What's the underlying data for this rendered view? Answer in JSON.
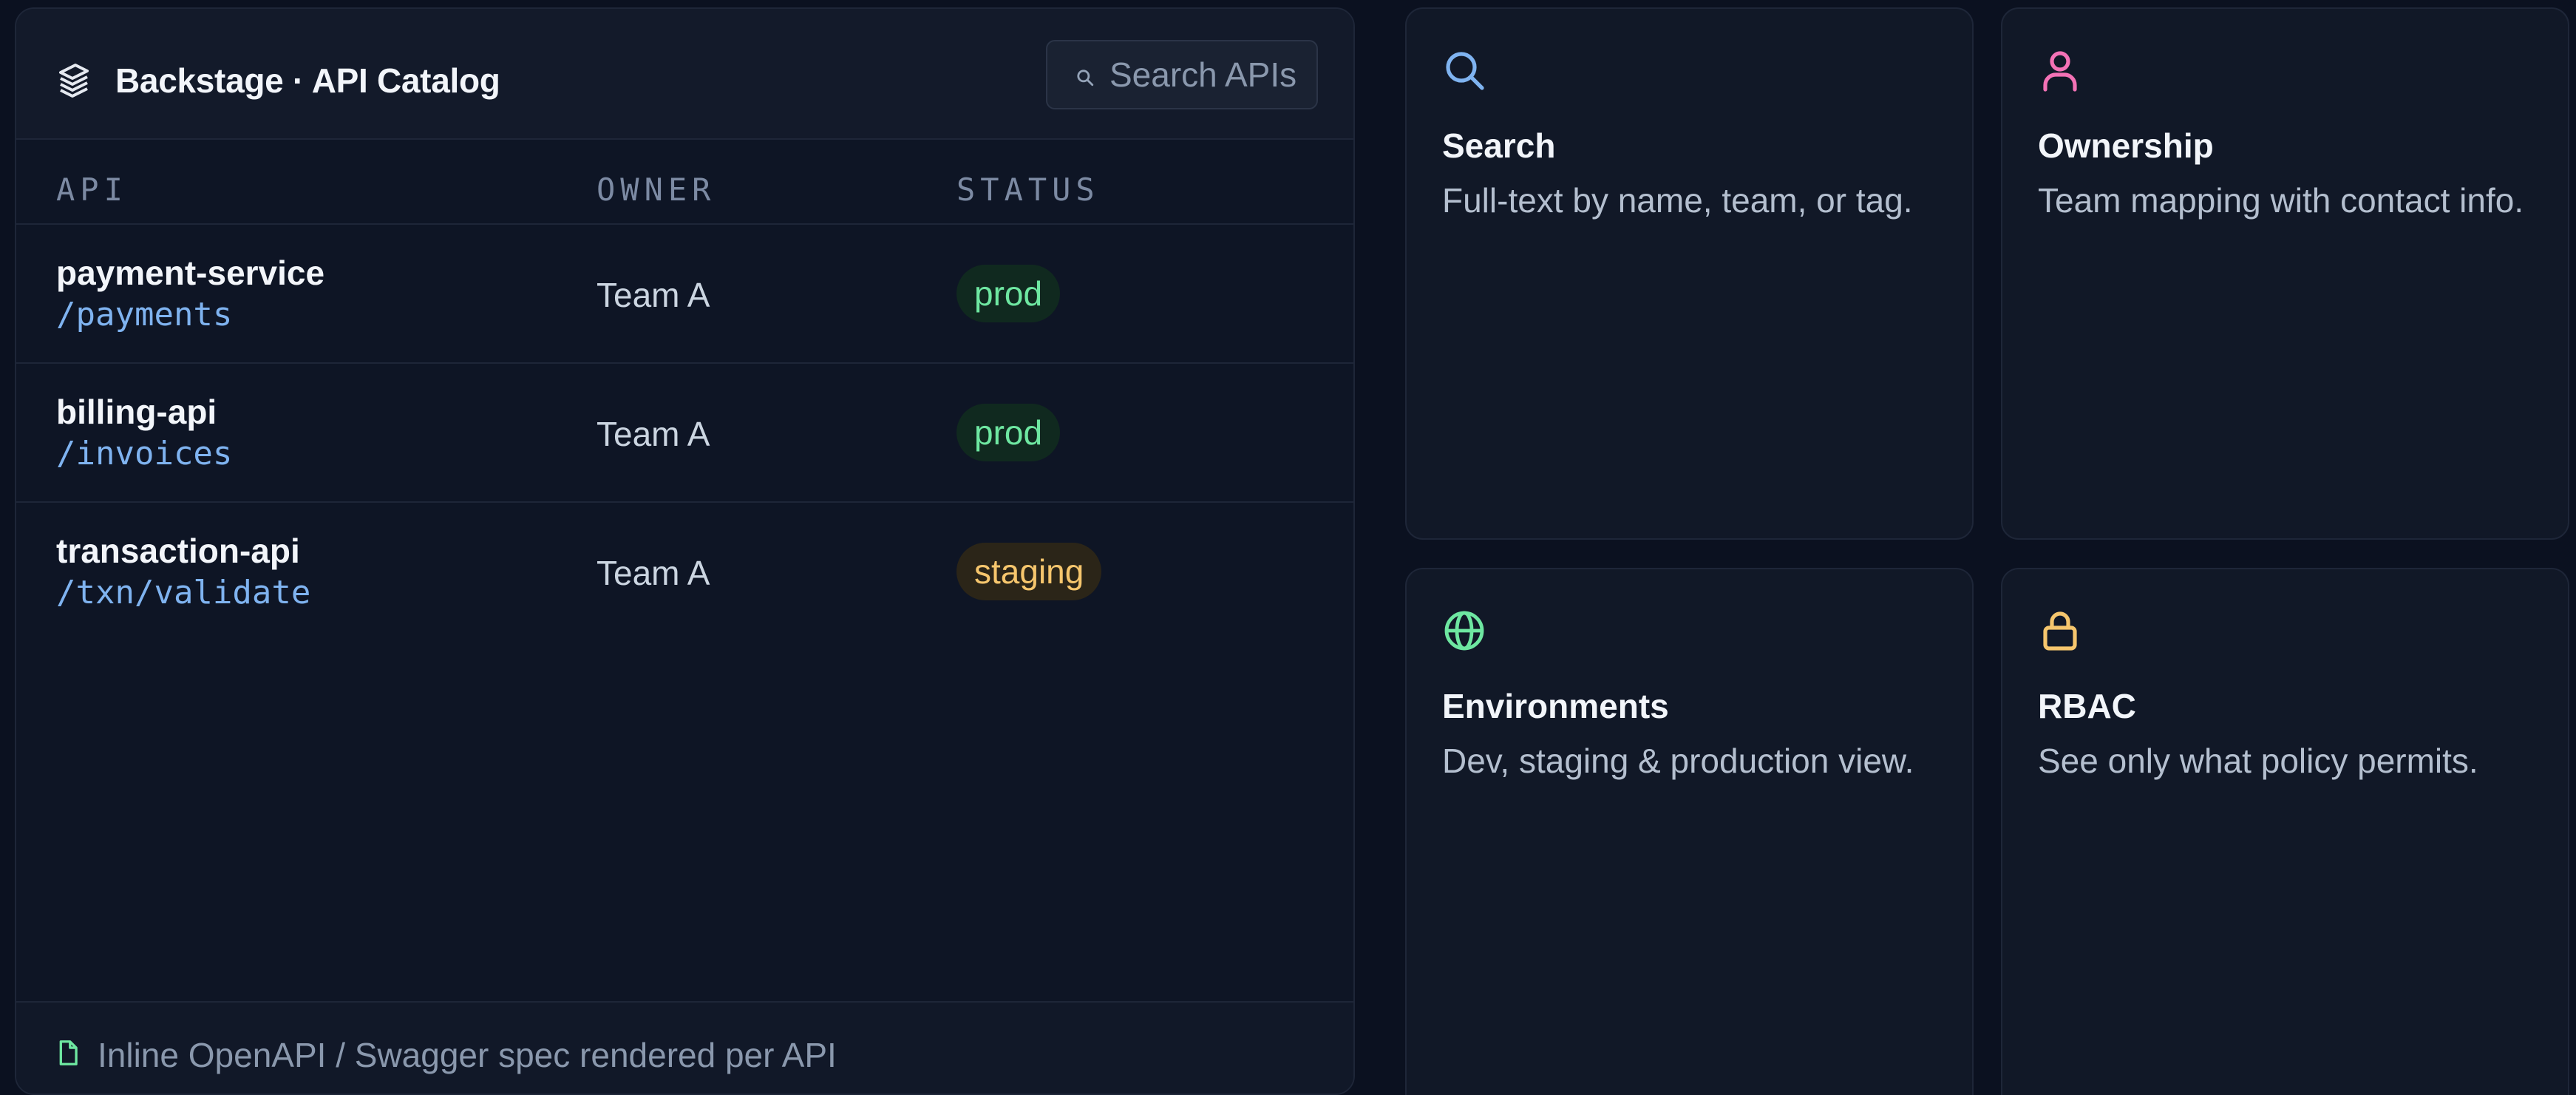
{
  "catalog": {
    "title": "Backstage · API Catalog",
    "logo_icon": "stack-icon",
    "search": {
      "placeholder": "Search APIs",
      "value": "",
      "icon": "search-icon"
    },
    "columns": [
      "API",
      "OWNER",
      "STATUS"
    ],
    "rows": [
      {
        "name": "payment-service",
        "path": "/payments",
        "owner": "Team A",
        "status": "prod"
      },
      {
        "name": "billing-api",
        "path": "/invoices",
        "owner": "Team A",
        "status": "prod"
      },
      {
        "name": "transaction-api",
        "path": "/txn/validate",
        "owner": "Team A",
        "status": "staging"
      }
    ],
    "footer": {
      "icon": "file-icon",
      "text": "Inline OpenAPI / Swagger spec rendered per API"
    }
  },
  "features": [
    {
      "icon": "search-icon",
      "title": "Search",
      "description": "Full-text by name, team, or tag."
    },
    {
      "icon": "user-icon",
      "title": "Ownership",
      "description": "Team mapping with contact info."
    },
    {
      "icon": "globe-icon",
      "title": "Environments",
      "description": "Dev, staging & production view."
    },
    {
      "icon": "lock-icon",
      "title": "RBAC",
      "description": "See only what policy permits."
    }
  ],
  "colors": {
    "background": "#0b1120",
    "prod": "#6ee7a1",
    "staging": "#f6c66d",
    "path_link": "#7fb3f0",
    "search_icon": "#7fb3f0",
    "user_icon": "#f472b6",
    "globe_icon": "#6ee7a1",
    "lock_icon": "#f6c66d"
  }
}
